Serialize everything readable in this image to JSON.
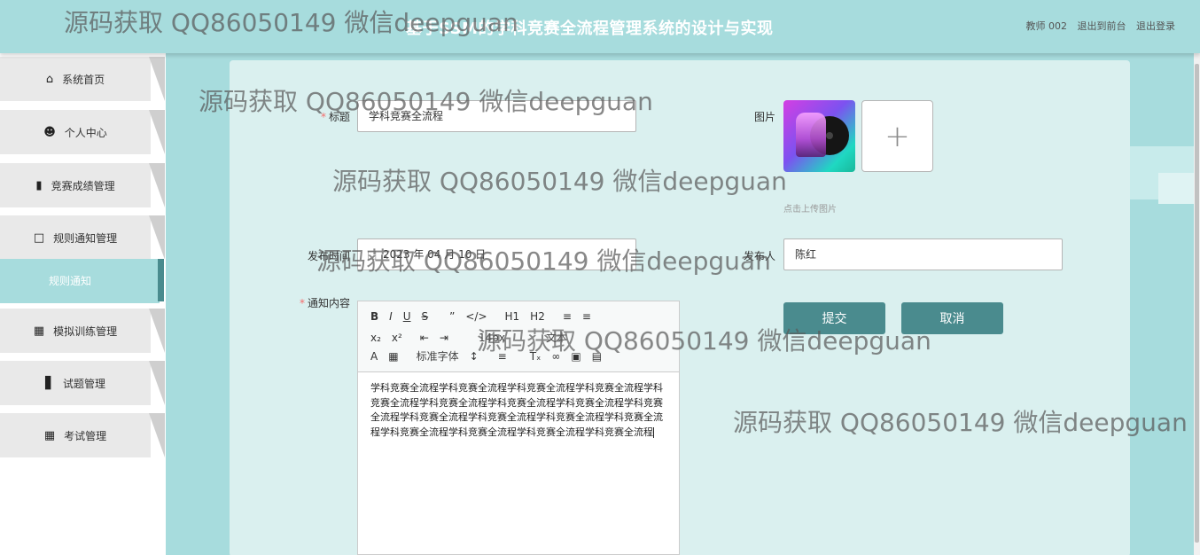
{
  "header": {
    "title": "基于SSM的学科竞赛全流程管理系统的设计与实现",
    "user": "教师 002",
    "back_to_front": "退出到前台",
    "logout": "退出登录"
  },
  "sidebar": {
    "items": [
      {
        "label": "系统首页",
        "icon": "home-icon"
      },
      {
        "label": "个人中心",
        "icon": "user-icon"
      },
      {
        "label": "竞赛成绩管理",
        "icon": "clipboard-icon"
      },
      {
        "label": "规则通知管理",
        "icon": "chart-icon"
      },
      {
        "label": "规则通知",
        "icon": ""
      },
      {
        "label": "模拟训练管理",
        "icon": "grid-icon"
      },
      {
        "label": "试题管理",
        "icon": "bar-chart-icon"
      },
      {
        "label": "考试管理",
        "icon": "grid-icon"
      }
    ]
  },
  "form": {
    "title_label": "标题",
    "title_value": "学科竞赛全流程",
    "image_label": "图片",
    "upload_hint": "点击上传图片",
    "publish_time_label": "发布时间",
    "publish_time_value": "2023 年 04 月 10 日",
    "publisher_label": "发布人",
    "publisher_value": "陈红",
    "content_label": "通知内容",
    "content_value": "学科竞赛全流程学科竞赛全流程学科竞赛全流程学科竞赛全流程学科竞赛全流程学科竞赛全流程学科竞赛全流程学科竞赛全流程学科竞赛全流程学科竞赛全流程学科竞赛全流程学科竞赛全流程学科竞赛全流程学科竞赛全流程学科竞赛全流程学科竞赛全流程学科竞赛全流程",
    "submit": "提交",
    "cancel": "取消"
  },
  "editor_toolbar": {
    "size_select": "14px",
    "text_select": "文本",
    "font_select": "标准字体"
  },
  "watermark_text": "源码获取 QQ86050149 微信deepguan",
  "colors": {
    "header_bg": "#a7dcdd",
    "active_nav": "#a7dcdd",
    "button": "#4a8b8e",
    "card_bg": "#daf0ef"
  }
}
